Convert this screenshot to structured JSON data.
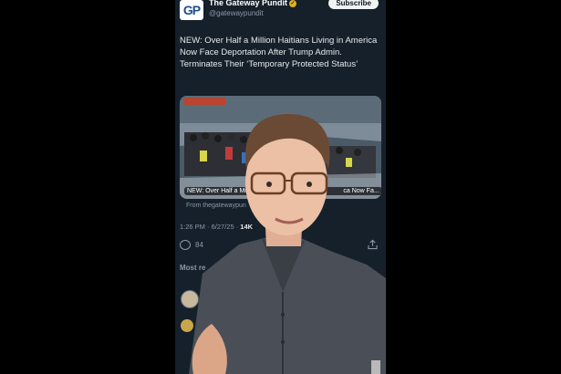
{
  "tweet": {
    "author_name": "The Gateway Pundit",
    "author_handle": "@gatewaypundit",
    "avatar_text": "GP",
    "subscribe_label": "Subscribe",
    "text": "NEW: Over Half a Million Haitians Living in America Now Face Deportation After Trump Admin. Terminates Their ‘Temporary Protected Status’",
    "card_caption": "NEW: Over Half a Mil",
    "card_caption_tail": "ca Now Fa...",
    "card_source": "From thegatewaypun",
    "time": "1:26 PM · 6/27/25 ·",
    "views": "14K",
    "reply_count": "84",
    "icons": [
      "verified-badge-icon",
      "reply-icon",
      "share-icon"
    ]
  },
  "section": {
    "most_relevant": "Most re"
  },
  "colors": {
    "background": "#15202b",
    "text": "#e7e9ea",
    "muted": "#8b98a5",
    "badge": "#e0b21c"
  }
}
